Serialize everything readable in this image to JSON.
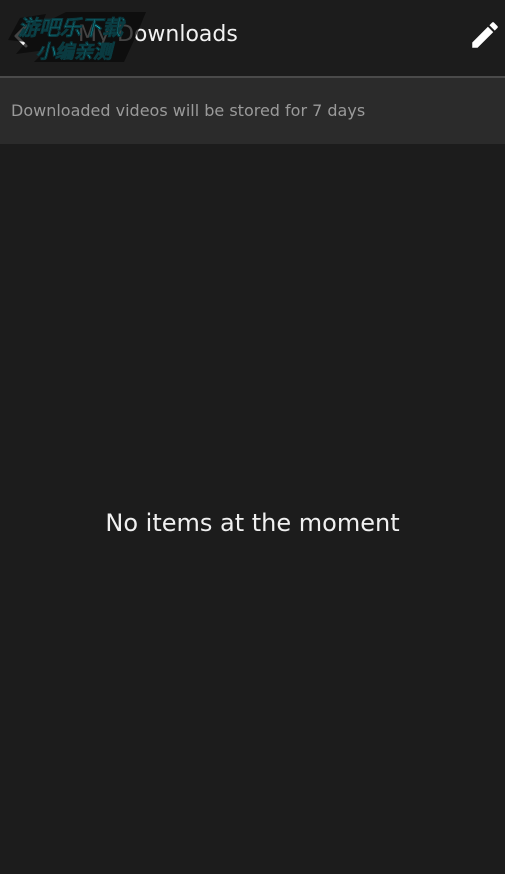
{
  "header": {
    "title": "My Downloads",
    "back_icon": "chevron-left-icon",
    "edit_icon": "pencil-icon"
  },
  "info_bar": {
    "text": "Downloaded videos will be stored for 7 days"
  },
  "empty_state": {
    "message": "No items at the moment"
  },
  "watermark": {
    "line1": "游吧乐下载",
    "line2": "小编亲测"
  },
  "colors": {
    "background": "#1c1c1c",
    "info_bar": "#2b2b2b",
    "watermark_cyan": "#1fe3f0"
  }
}
